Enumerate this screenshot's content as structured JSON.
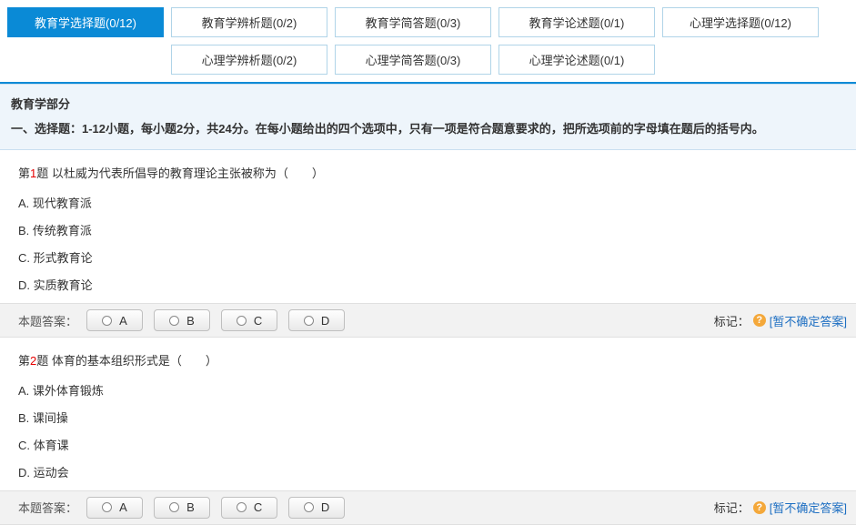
{
  "tabs": {
    "row1": [
      {
        "label": "教育学选择题(0/12)",
        "active": true
      },
      {
        "label": "教育学辨析题(0/2)",
        "active": false
      },
      {
        "label": "教育学简答题(0/3)",
        "active": false
      },
      {
        "label": "教育学论述题(0/1)",
        "active": false
      },
      {
        "label": "心理学选择题(0/12)",
        "active": false
      }
    ],
    "row2": [
      {
        "label": "心理学辨析题(0/2)",
        "active": false
      },
      {
        "label": "心理学简答题(0/3)",
        "active": false
      },
      {
        "label": "心理学论述题(0/1)",
        "active": false
      }
    ]
  },
  "section": {
    "title": "教育学部分",
    "instruction": "一、选择题：1-12小题，每小题2分，共24分。在每小题给出的四个选项中，只有一项是符合题意要求的，把所选项前的字母填在题后的括号内。"
  },
  "questions": [
    {
      "num_prefix": "第",
      "num": "1",
      "num_suffix": "题",
      "stem": " 以杜威为代表所倡导的教育理论主张被称为（　　）",
      "options": [
        "A. 现代教育派",
        "B. 传统教育派",
        "C. 形式教育论",
        "D. 实质教育论"
      ]
    },
    {
      "num_prefix": "第",
      "num": "2",
      "num_suffix": "题",
      "stem": " 体育的基本组织形式是（　　）",
      "options": [
        "A. 课外体育锻炼",
        "B. 课间操",
        "C. 体育课",
        "D. 运动会"
      ]
    }
  ],
  "answer_bar": {
    "label": "本题答案：",
    "buttons": [
      "A",
      "B",
      "C",
      "D"
    ],
    "mark_label": "标记：",
    "help": "?",
    "mark_link": "[暂不确定答案]"
  }
}
